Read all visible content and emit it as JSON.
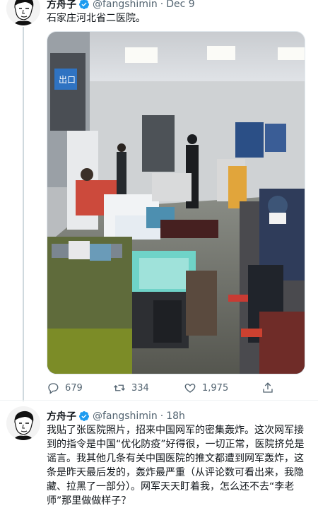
{
  "tweet1": {
    "author_name": "方舟子",
    "author_handle": "@fangshimin",
    "separator": "·",
    "date": "Dec 9",
    "text": "石家庄河北省二医院。",
    "photo_label": "出口",
    "reply_count": "679",
    "retweet_count": "334",
    "like_count": "1,975"
  },
  "tweet2": {
    "author_name": "方舟子",
    "author_handle": "@fangshimin",
    "separator": "·",
    "date": "18h",
    "text": "我贴了张医院照片，招来中国网军的密集轰炸。这次网军接到的指令是中国“优化防疫”好得很，一切正常，医院挤兑是谣言。我其他几条有关中国医院的推文都遭到网军轰炸，这条是昨天最后发的，轰炸最严重（从评论数可看出来，我隐藏、拉黑了一部分）。网军天天盯着我，怎么还不去“李老师”那里做做样子？"
  },
  "colors": {
    "verified": "#1d9bf0",
    "muted": "#536471",
    "text": "#0f1419"
  }
}
